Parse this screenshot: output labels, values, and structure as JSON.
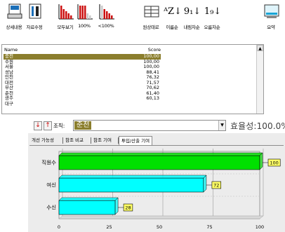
{
  "toolbar": {
    "buttons": [
      {
        "label": "상세내용",
        "icon": "detail-report-icon"
      },
      {
        "label": "자료수정",
        "icon": "edit-data-icon"
      },
      {
        "label": "모두보기",
        "icon": "all-bars-icon"
      },
      {
        "label": "100%",
        "icon": "bars-100-icon"
      },
      {
        "label": "<100%",
        "icon": "bars-under-100-icon"
      },
      {
        "label": "원상태로",
        "icon": "restore-table-icon"
      },
      {
        "label": "이름순",
        "icon": "sort-az-icon",
        "glyph": "ᴬZ↓"
      },
      {
        "label": "내림차순",
        "icon": "sort-desc-icon",
        "glyph": "9₁↓"
      },
      {
        "label": "오름차순",
        "icon": "sort-asc-icon",
        "glyph": "1₉↓"
      },
      {
        "label": "요약",
        "icon": "summary-icon"
      }
    ]
  },
  "list": {
    "columns": {
      "name": "Name",
      "score": "Score"
    },
    "rows": [
      {
        "name": "충전",
        "score": "100,00",
        "selected": true
      },
      {
        "name": "수원",
        "score": "100,00"
      },
      {
        "name": "서울",
        "score": "100,00"
      },
      {
        "name": "성남",
        "score": "88,41"
      },
      {
        "name": "인천",
        "score": "76,32"
      },
      {
        "name": "대전",
        "score": "71,57"
      },
      {
        "name": "부산",
        "score": "70,62"
      },
      {
        "name": "춘천",
        "score": "61,40"
      },
      {
        "name": "광주",
        "score": "60,13"
      },
      {
        "name": "대구",
        "score": ""
      }
    ]
  },
  "efficiency": {
    "down_arrow": "↓",
    "up_arrow": "↑",
    "condition_label": "조직:",
    "condition_value": "춘천",
    "efficiency_text": "효율성:100.0%",
    "tabs": [
      {
        "label": "개선 가능성",
        "active": false
      },
      {
        "label": "참조 비교",
        "active": false
      },
      {
        "label": "참조 기여",
        "active": false
      },
      {
        "label": "투입/산출 기여",
        "active": true
      }
    ]
  },
  "colors": {
    "selected_bg": "#8b7e2d",
    "bar_green": "#00e000",
    "bar_cyan": "#00ffff",
    "label_box": "#ffff66",
    "icon_red": "#cc1111"
  },
  "chart_data": {
    "type": "bar",
    "orientation": "horizontal",
    "categories": [
      "직원수",
      "여신",
      "수신"
    ],
    "values": [
      100,
      72,
      28
    ],
    "data_labels": [
      "100",
      "72",
      "28"
    ],
    "bar_colors": [
      "#00e000",
      "#00ffff",
      "#00ffff"
    ],
    "xlim": [
      0,
      100
    ],
    "xticks": [
      0,
      25,
      50,
      75,
      100
    ],
    "grid": true
  }
}
